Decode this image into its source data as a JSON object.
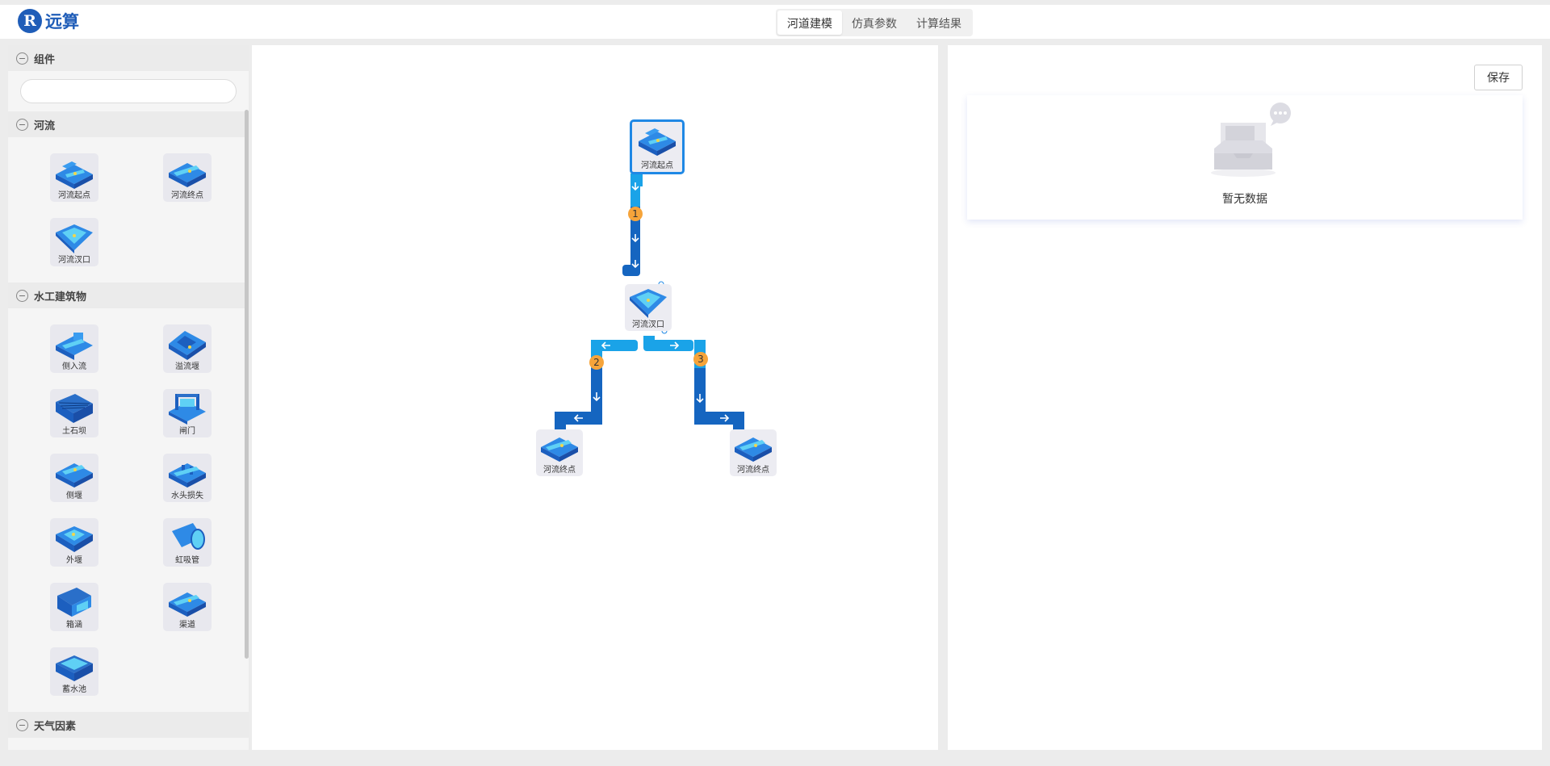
{
  "app": {
    "logo_letter": "R",
    "name": "远算"
  },
  "tabs": [
    {
      "label": "河道建模",
      "active": true
    },
    {
      "label": "仿真参数",
      "active": false
    },
    {
      "label": "计算结果",
      "active": false
    }
  ],
  "sidebar": {
    "components_header": "组件",
    "search_placeholder": "",
    "sections": [
      {
        "title": "河流",
        "items": [
          "河流起点",
          "河流终点",
          "河流汊口"
        ]
      },
      {
        "title": "水工建筑物",
        "items": [
          "侧入流",
          "溢流堰",
          "土石坝",
          "闸门",
          "侧堰",
          "水头损失",
          "外堰",
          "虹吸管",
          "箱涵",
          "渠道",
          "蓄水池"
        ]
      },
      {
        "title": "天气因素",
        "items": []
      }
    ]
  },
  "canvas": {
    "nodes": [
      {
        "label": "河流起点",
        "selected": true
      },
      {
        "label": "河流汊口",
        "selected": false
      },
      {
        "label": "河流终点",
        "selected": false
      },
      {
        "label": "河流终点",
        "selected": false
      }
    ],
    "edges": [
      {
        "id": "1"
      },
      {
        "id": "2"
      },
      {
        "id": "3"
      }
    ]
  },
  "right_panel": {
    "save_label": "保存",
    "empty_text": "暂无数据"
  },
  "colors": {
    "brand": "#1f5db8",
    "pipe_light": "#1aa3e8",
    "pipe_dark": "#1565c0",
    "badge": "#f6a43a",
    "selected_border": "#1f88e5"
  }
}
